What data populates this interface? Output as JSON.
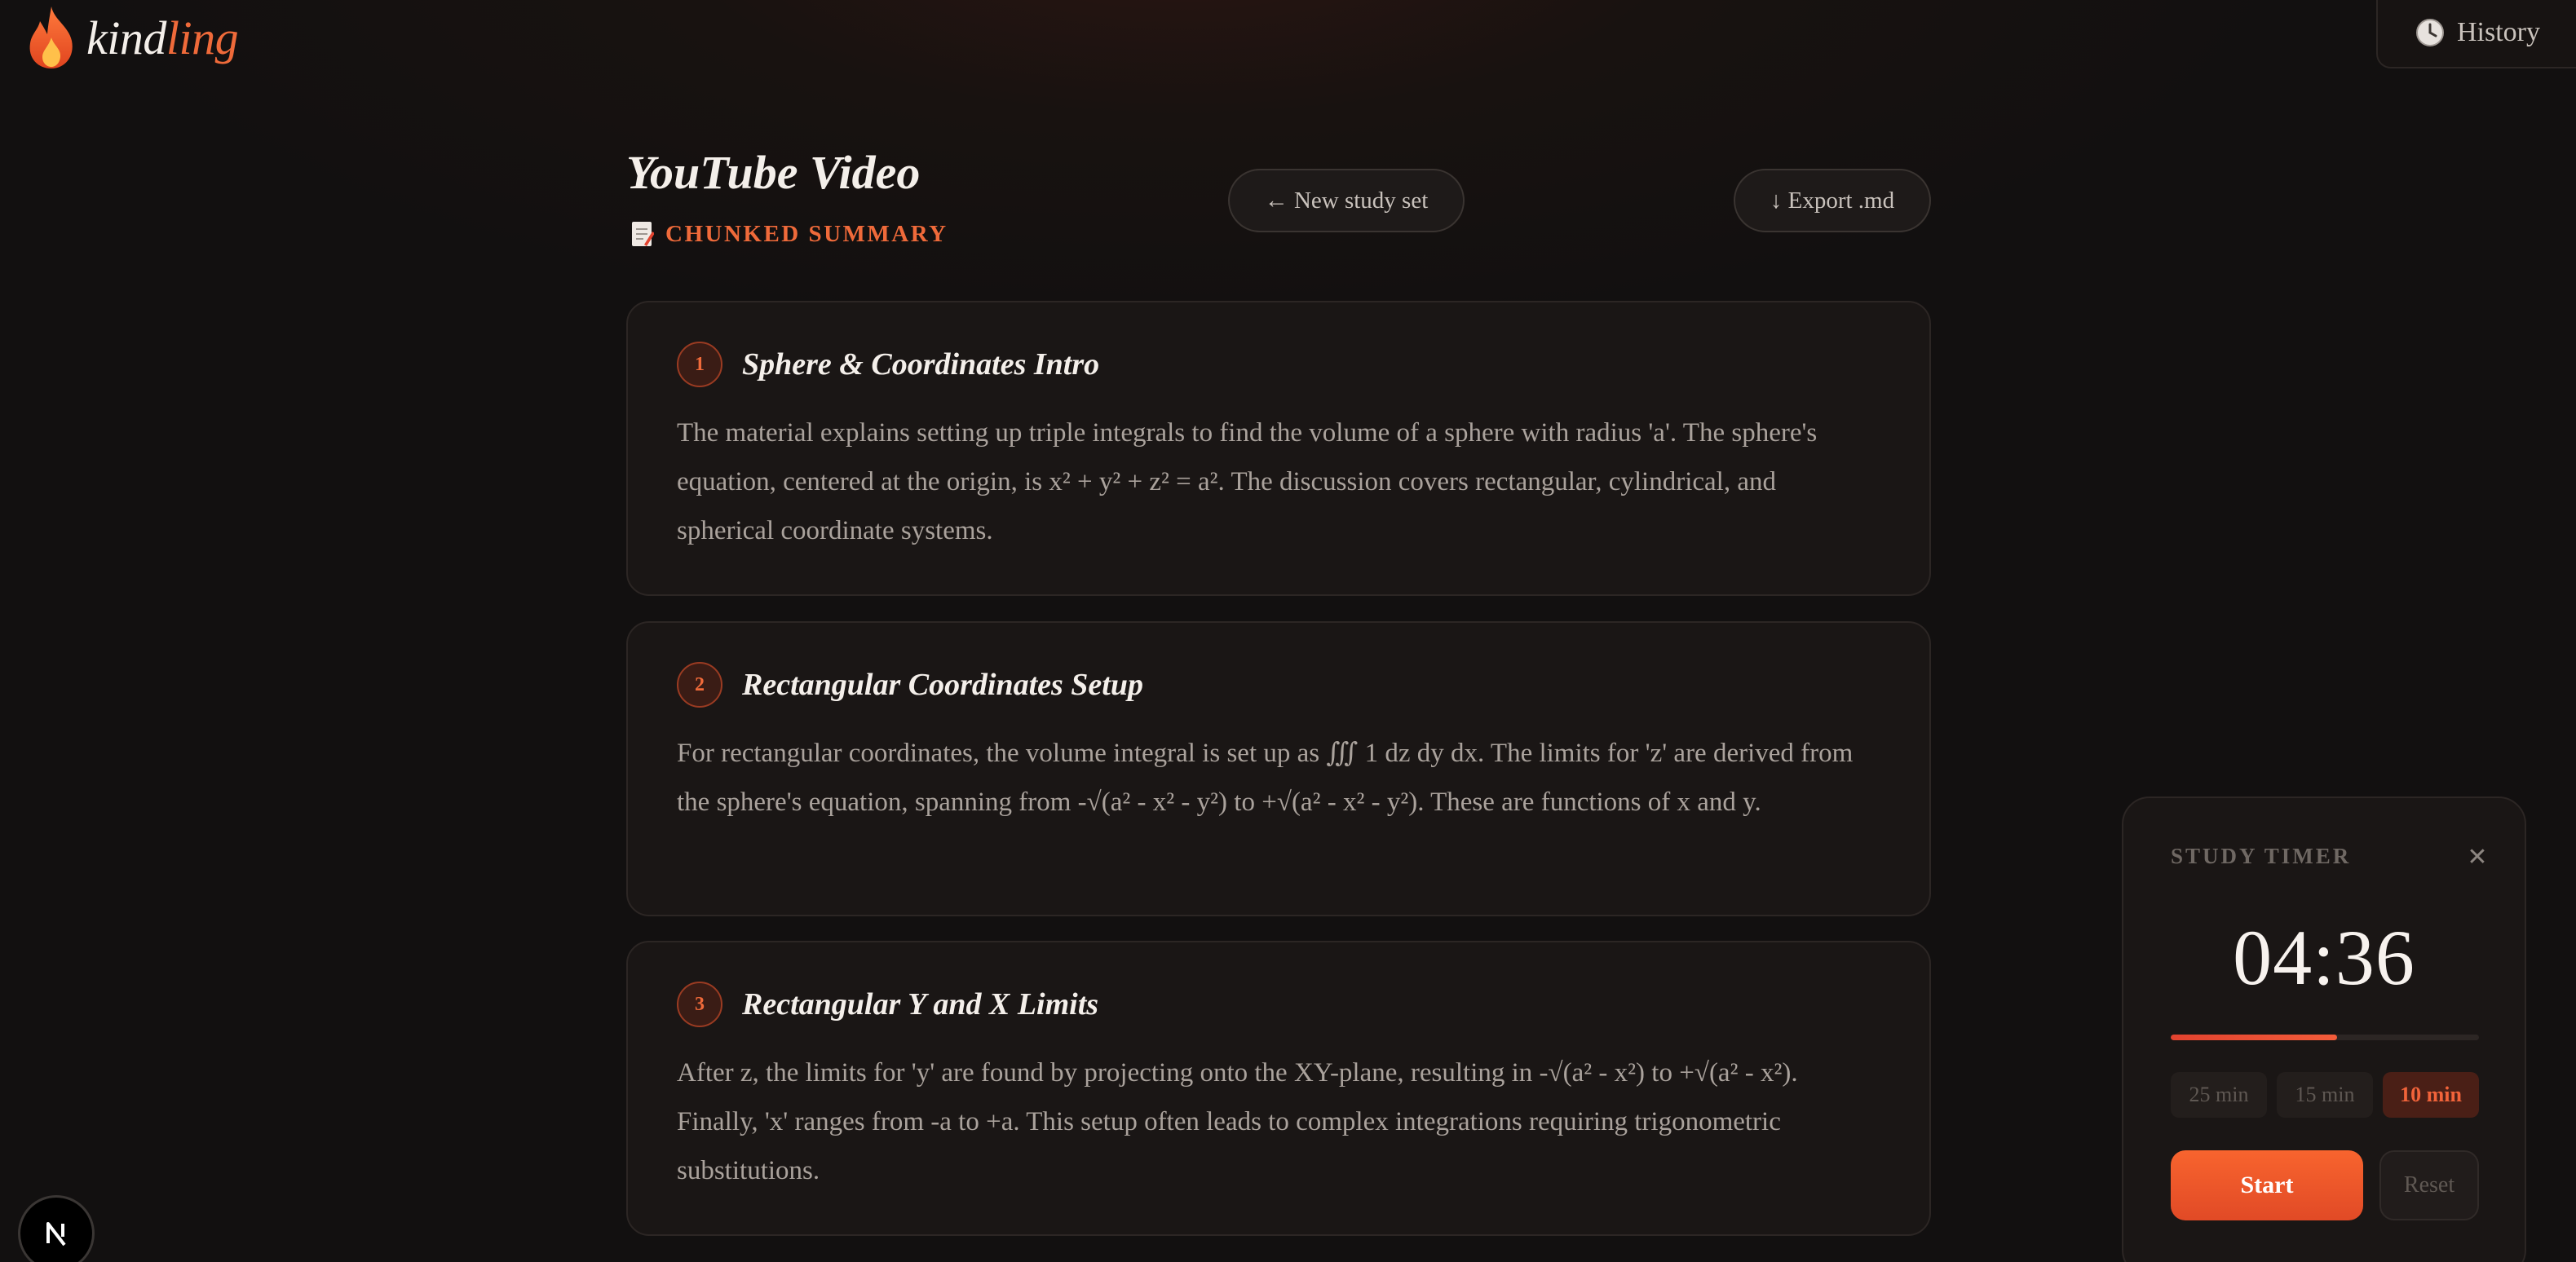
{
  "app": {
    "logo_part1": "kind",
    "logo_part2": "ling",
    "brand_color": "#ef6a3a"
  },
  "header": {
    "history_label": "History",
    "history_icon": "clock-icon"
  },
  "page": {
    "title": "YouTube Video",
    "subtitle": "CHUNKED SUMMARY",
    "subtitle_icon": "memo-icon",
    "new_study_set_label": "← New study set",
    "export_label": "↓ Export .md"
  },
  "chunks": [
    {
      "number": "1",
      "title": "Sphere & Coordinates Intro",
      "body": "The material explains setting up triple integrals to find the volume of a sphere with radius 'a'. The sphere's equation, centered at the origin, is x² + y² + z² = a². The discussion covers rectangular, cylindrical, and spherical coordinate systems."
    },
    {
      "number": "2",
      "title": "Rectangular Coordinates Setup",
      "body": "For rectangular coordinates, the volume integral is set up as ∭ 1 dz dy dx. The limits for 'z' are derived from the sphere's equation, spanning from -√(a² - x² - y²) to +√(a² - x² - y²). These are functions of x and y."
    },
    {
      "number": "3",
      "title": "Rectangular Y and X Limits",
      "body": "After z, the limits for 'y' are found by projecting onto the XY-plane, resulting in -√(a² - x²) to +√(a² - x²). Finally, 'x' ranges from -a to +a. This setup often leads to complex integrations requiring trigonometric substitutions."
    }
  ],
  "timer": {
    "label": "STUDY TIMER",
    "close_symbol": "✕",
    "display": "04:36",
    "progress_fraction": 0.54,
    "presets": [
      "25 min",
      "15 min",
      "10 min"
    ],
    "active_preset": "10 min",
    "start_label": "Start",
    "reset_label": "Reset",
    "accent_color": "#f35c3a"
  },
  "dev_badge": {
    "letter": "N"
  }
}
